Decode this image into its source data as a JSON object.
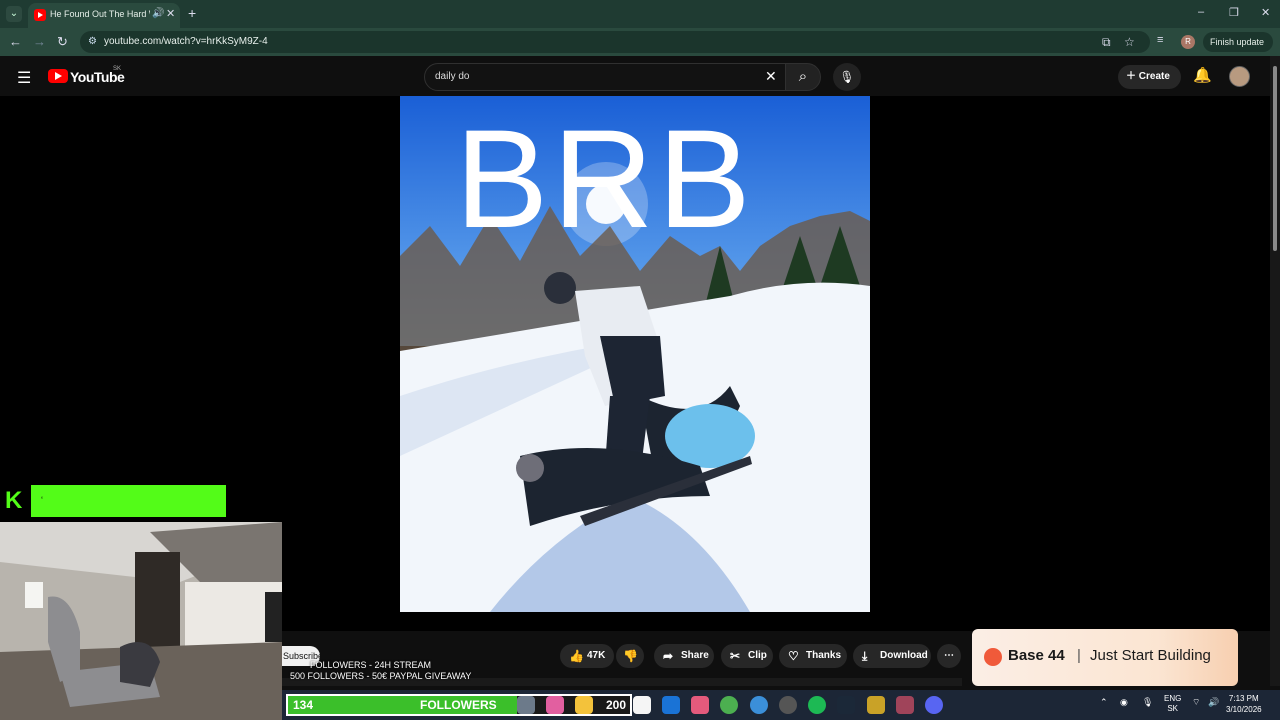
{
  "browser": {
    "tab_title": "He Found Out The Hard W",
    "url": "youtube.com/watch?v=hrKkSyM9Z-4",
    "finish_update": "Finish update",
    "profile_initial": "R"
  },
  "youtube": {
    "logo_text": "YouTube",
    "country": "SK",
    "search_value": "daily do",
    "create_label": "Create"
  },
  "overlay": {
    "brb": "BRB",
    "kick_logo": "K",
    "kick_chat": "‘",
    "goal_lines": [
      "FOLLOWERS - 24H STREAM",
      "500 FOLLOWERS - 50€ PAYPAL GIVEAWAY"
    ]
  },
  "actions": {
    "subscribe": "Subscribe",
    "likes": "47K",
    "share": "Share",
    "clip": "Clip",
    "thanks": "Thanks",
    "download": "Download"
  },
  "ad": {
    "brand": "Base 44",
    "separator": "|",
    "tagline": "Just Start Building"
  },
  "follower_goal": {
    "current": "134",
    "label": "FOLLOWERS",
    "goal": "200",
    "progress": 0.67
  },
  "taskbar": {
    "lang": "ENG",
    "region": "SK",
    "time": "7:13 PM",
    "date": "3/10/2026"
  },
  "colors": {
    "youtube_red": "#ff0000",
    "kick_green": "#53fc18",
    "browser_frame": "#1f3b32"
  }
}
